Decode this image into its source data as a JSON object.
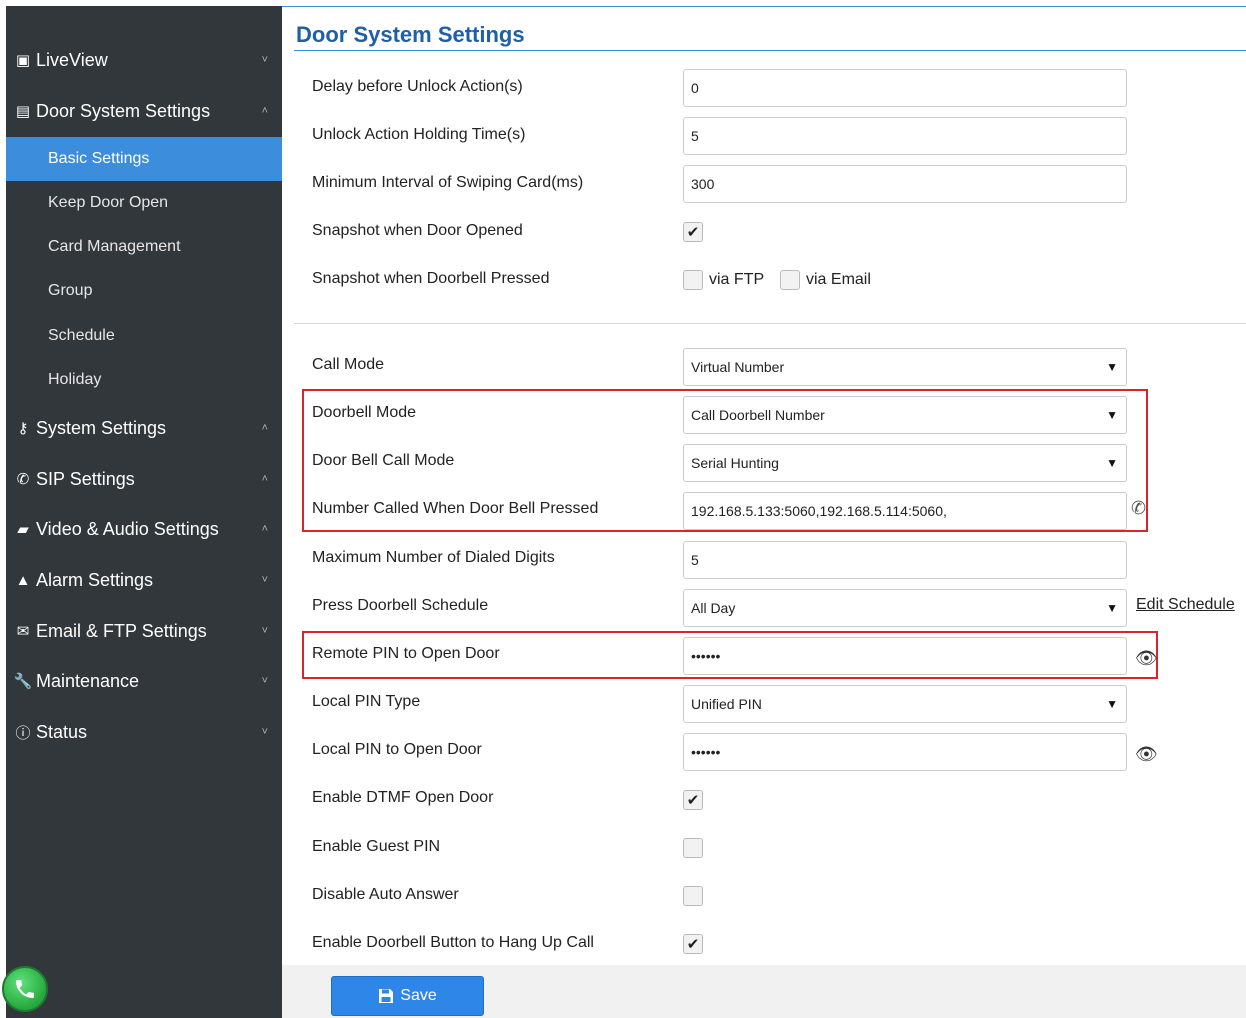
{
  "sidebar": {
    "items": [
      {
        "label": "LiveView",
        "icon": "video-icon",
        "glyph": "▣",
        "chevron": "˅"
      },
      {
        "label": "Door System Settings",
        "icon": "door-card-icon",
        "glyph": "▤",
        "chevron": "˄"
      },
      {
        "label": "System Settings",
        "icon": "key-icon",
        "glyph": "⚷",
        "chevron": "˄"
      },
      {
        "label": "SIP Settings",
        "icon": "phone-icon",
        "glyph": "✆",
        "chevron": "˄"
      },
      {
        "label": "Video & Audio Settings",
        "icon": "camera-icon",
        "glyph": "▰",
        "chevron": "˄"
      },
      {
        "label": "Alarm Settings",
        "icon": "bell-icon",
        "glyph": "▲",
        "chevron": "˅"
      },
      {
        "label": "Email & FTP Settings",
        "icon": "email-icon",
        "glyph": "✉",
        "chevron": "˅"
      },
      {
        "label": "Maintenance",
        "icon": "wrench-icon",
        "glyph": "🔧",
        "chevron": "˅"
      },
      {
        "label": "Status",
        "icon": "info-icon",
        "glyph": "ⓘ",
        "chevron": "˅"
      }
    ],
    "sub_items": [
      "Basic Settings",
      "Keep Door Open",
      "Card Management",
      "Group",
      "Schedule",
      "Holiday"
    ],
    "active_sub": "Basic Settings"
  },
  "page": {
    "title": "Door System Settings",
    "delay_label": "Delay before Unlock Action(s)",
    "delay_value": "0",
    "holding_label": "Unlock Action Holding Time(s)",
    "holding_value": "5",
    "interval_label": "Minimum Interval of Swiping Card(ms)",
    "interval_value": "300",
    "snap_open_label": "Snapshot when Door Opened",
    "snap_open_checked": "✔",
    "snap_bell_label": "Snapshot when Doorbell Pressed",
    "via_ftp": "via FTP",
    "via_email": "via Email",
    "call_mode_label": "Call Mode",
    "call_mode_value": "Virtual Number",
    "doorbell_mode_label": "Doorbell Mode",
    "doorbell_mode_value": "Call Doorbell Number",
    "bell_call_mode_label": "Door Bell Call Mode",
    "bell_call_mode_value": "Serial Hunting",
    "number_called_label": "Number Called When Door Bell Pressed",
    "number_called_value": "192.168.5.133:5060,192.168.5.114:5060,",
    "max_digits_label": "Maximum Number of Dialed Digits",
    "max_digits_value": "5",
    "schedule_label": "Press Doorbell Schedule",
    "schedule_value": "All Day",
    "edit_schedule": "Edit Schedule",
    "remote_pin_label": "Remote PIN to Open Door",
    "remote_pin_value": "••••••",
    "local_pin_type_label": "Local PIN Type",
    "local_pin_type_value": "Unified PIN",
    "local_pin_label": "Local PIN to Open Door",
    "local_pin_value": "••••••",
    "dtmf_label": "Enable DTMF Open Door",
    "dtmf_checked": "✔",
    "guest_pin_label": "Enable Guest PIN",
    "auto_answer_label": "Disable Auto Answer",
    "hangup_label": "Enable Doorbell Button to Hang Up Call",
    "hangup_checked": "✔",
    "dropdown_arrow": "▼",
    "eye_glyph": "👁",
    "call_glyph": "✆"
  },
  "footer": {
    "save_label": "Save",
    "save_icon": "floppy-disk-icon"
  },
  "colors": {
    "sidebar_bg": "#32373b",
    "accent": "#3c8ddc",
    "title": "#1f5fa8",
    "highlight": "#d9232d",
    "save_bg": "#2e87e8"
  }
}
